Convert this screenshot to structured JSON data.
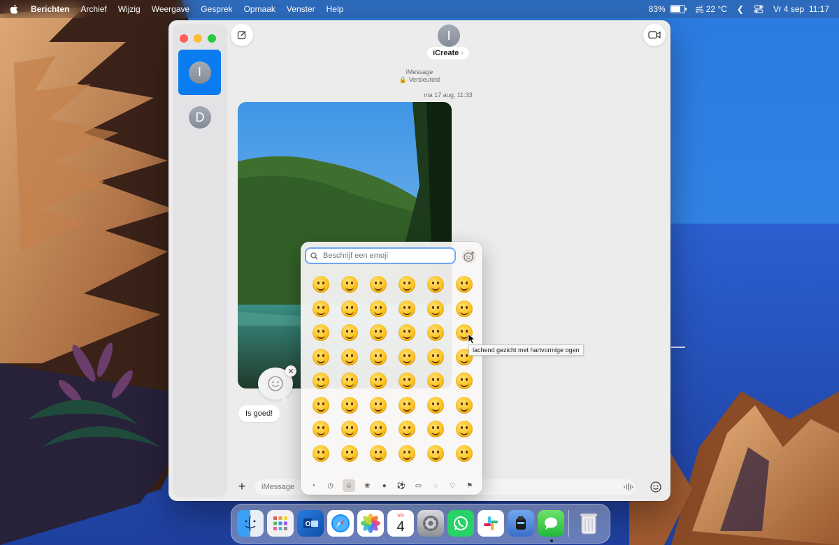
{
  "menubar": {
    "apple_icon": "apple-icon",
    "app_name": "Berichten",
    "menus": [
      "Archief",
      "Wijzig",
      "Weergave",
      "Gesprek",
      "Opmaak",
      "Venster",
      "Help"
    ],
    "battery": "83%",
    "battery_level": 0.83,
    "weather": "22 °C",
    "datetime": "Vr 4 sep  11:17"
  },
  "sidebar": {
    "conversations": [
      {
        "initial": "I",
        "selected": true
      },
      {
        "initial": "D",
        "selected": false
      }
    ]
  },
  "chat": {
    "contact_initial": "I",
    "contact_name": "iCreate",
    "contact_chevron": "›",
    "service": "iMessage",
    "encryption": "🔒 Versleuteld",
    "timestamp": "ma 17 aug, 11:33",
    "reply_text": "Is goed!",
    "tapback_close": "✕",
    "input_placeholder": "iMessage",
    "plus": "+"
  },
  "emoji_picker": {
    "search_placeholder": "Beschrijf een emoji",
    "tooltip": "lachend gezicht met hartvormige ogen",
    "emojis": [
      "😀",
      "😃",
      "😄",
      "😁",
      "😆",
      "🥹",
      "😅",
      "😂",
      "🤣",
      "🥲",
      "☺️",
      "😊",
      "😇",
      "🙂",
      "🙃",
      "😉",
      "😌",
      "😍",
      "🥰",
      "😘",
      "😗",
      "😙",
      "😚",
      "😋",
      "😛",
      "😝",
      "😜",
      "🤪",
      "🤨",
      "🧐",
      "🤓",
      "😎",
      "🥸",
      "🤩",
      "🥳",
      "😏",
      "😒",
      "😞",
      "😔",
      "😟",
      "😕",
      "🙁",
      "☹️",
      "😣",
      "😖",
      "😫",
      "😩",
      "🥺"
    ],
    "categories": [
      "recent-icon",
      "clock-icon",
      "smileys-icon",
      "animals-icon",
      "food-icon",
      "activity-icon",
      "travel-icon",
      "objects-icon",
      "symbols-icon",
      "flags-icon"
    ],
    "active_category": 2
  },
  "dock": {
    "apps": [
      "Finder",
      "Launchpad",
      "Outlook",
      "Safari",
      "Foto's",
      "Agenda",
      "Systeeminstellingen",
      "WhatsApp",
      "Slack",
      "Bewaar",
      "Berichten",
      "Prullenmand"
    ],
    "calendar_month": "VR",
    "calendar_day": "4"
  },
  "colors": {
    "accent": "#0a7cf0",
    "sky": "#2f7fe0",
    "sea": "#2a58c8"
  }
}
